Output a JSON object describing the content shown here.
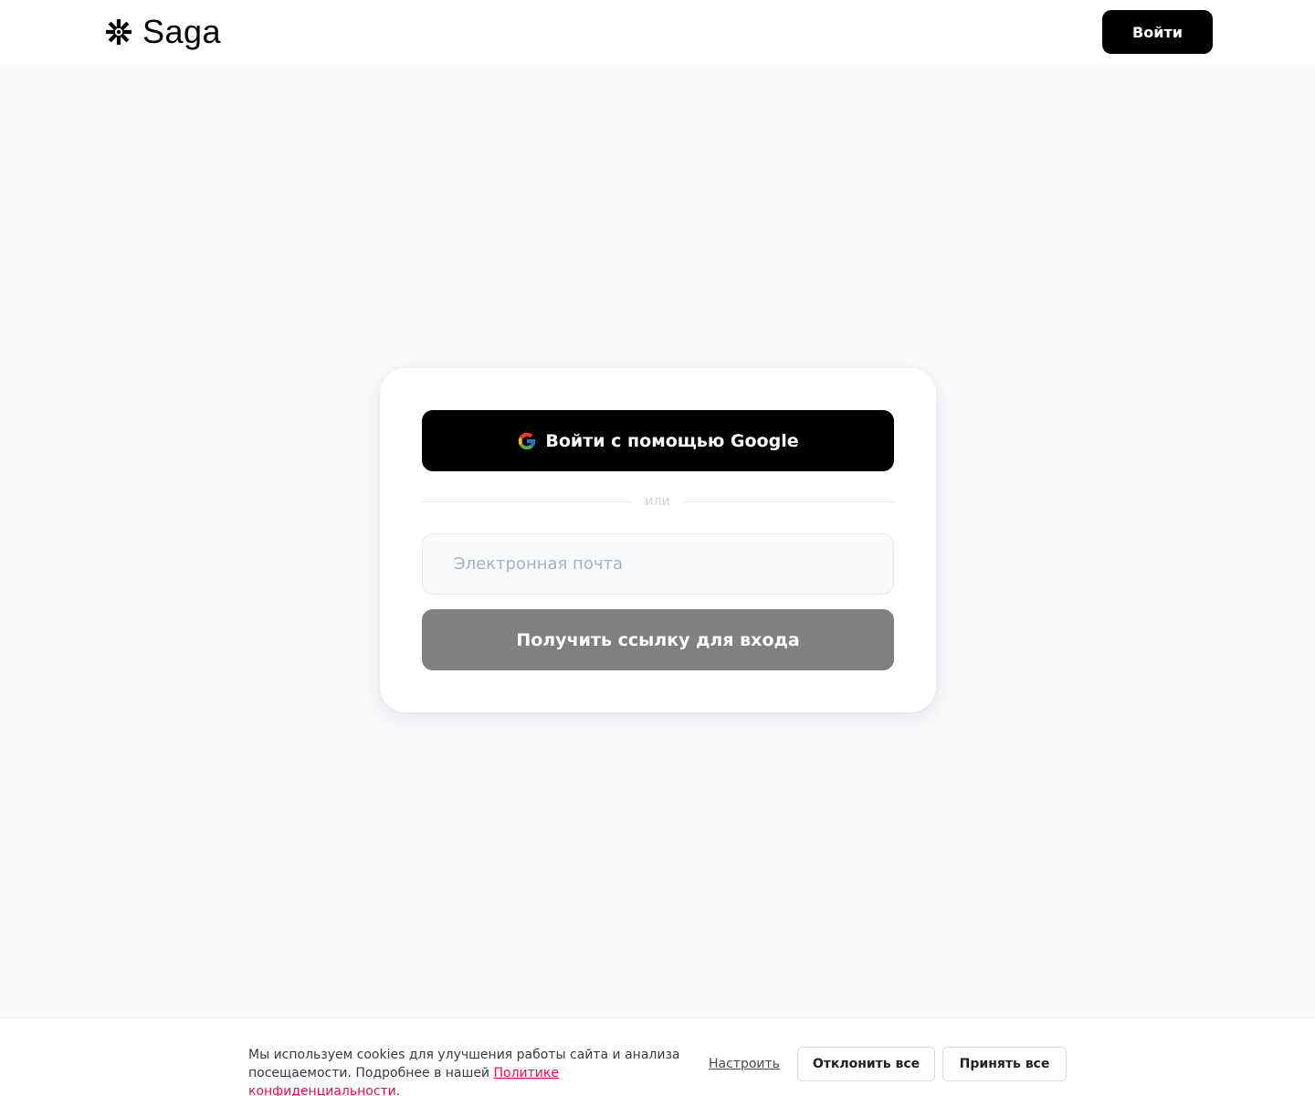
{
  "header": {
    "logo_text": "Saga",
    "login_label": "Войти"
  },
  "card": {
    "google_label": "Войти с помощью Google",
    "divider_label": "или",
    "email_placeholder": "Электронная почта",
    "email_value": "",
    "submit_label": "Получить ссылку для входа"
  },
  "cookie": {
    "text_before": "Мы используем cookies для улучшения работы сайта и анализа посещаемости. Подробнее в нашей ",
    "policy_link": "Политике конфиденциальности",
    "text_after": ".",
    "settings_label": "Настроить",
    "decline_label": "Отклонить все",
    "accept_label": "Принять все"
  },
  "colors": {
    "brand_black": "#000000",
    "disabled_button": "#808080",
    "policy_link": "#e0114a",
    "page_background": "#f8f9fb"
  },
  "icons": {
    "logo": "asterisk-logo-icon",
    "google": "google-g-icon"
  }
}
